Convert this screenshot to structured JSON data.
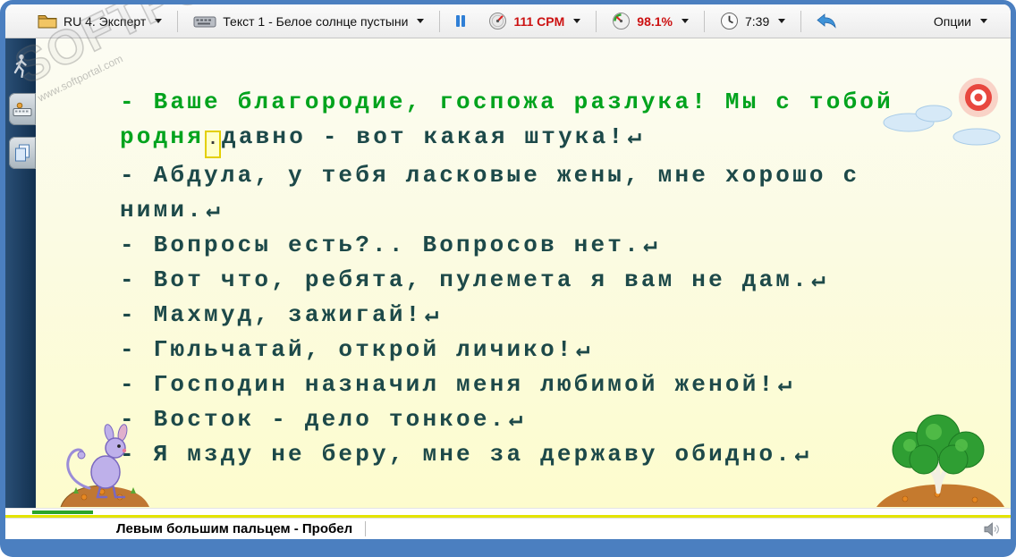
{
  "window": {
    "frame_color": "#4b7fc0"
  },
  "toolbar": {
    "lesson": {
      "label": "RU 4. Эксперт"
    },
    "text": {
      "label": "Текст 1 - Белое солнце пустыни"
    },
    "speed": {
      "value": "111 CPM"
    },
    "accuracy": {
      "value": "98.1%"
    },
    "time": {
      "value": "7:39"
    },
    "options": {
      "label": "Опции"
    }
  },
  "colors": {
    "typed": "#00a31d",
    "untyped": "#1d4949",
    "stat-red": "#cc1111",
    "frame": "#4b7fc0"
  },
  "icons": [
    "folder-icon",
    "keyboard-icon",
    "pause-icon",
    "speedometer-icon",
    "accuracy-gauge-icon",
    "clock-icon",
    "undo-arrow-icon",
    "dropdown-caret-icon",
    "walking-person-icon",
    "hands-keyboard-icon",
    "copy-pages-icon",
    "speaker-icon",
    "sun-clouds-decoration",
    "jerboa-mouse-decoration",
    "saxaul-tree-decoration"
  ],
  "typing": {
    "cursor_char": "·",
    "return_symbol": "↵",
    "lines": [
      {
        "typed": "- Ваше благородие, госпожа разлука! Мы с тобой",
        "rest": "",
        "cursor": false,
        "eol": false
      },
      {
        "typed": "родня",
        "cursor": true,
        "rest": "давно - вот какая штука!",
        "eol": true
      },
      {
        "typed": "",
        "rest": "- Абдула, у тебя ласковые жены, мне хорошо с",
        "eol": false
      },
      {
        "typed": "",
        "rest": "ними.",
        "eol": true
      },
      {
        "typed": "",
        "rest": "- Вопросы есть?.. Вопросов нет.",
        "eol": true
      },
      {
        "typed": "",
        "rest": "- Вот что, ребята, пулемета я вам не дам.",
        "eol": true
      },
      {
        "typed": "",
        "rest": "- Махмуд, зажигай!",
        "eol": true
      },
      {
        "typed": "",
        "rest": "- Гюльчатай, открой личико!",
        "eol": true
      },
      {
        "typed": "",
        "rest": "- Господин назначил меня любимой женой!",
        "eol": true
      },
      {
        "typed": "",
        "rest": "- Восток - дело тонкое.",
        "eol": true
      },
      {
        "typed": "",
        "rest": "- Я мзду не беру, мне за державу обидно.",
        "eol": true
      }
    ]
  },
  "statusbar": {
    "hint": "Левым большим пальцем - Пробел"
  },
  "watermark": {
    "title": "SOFTPORTAL",
    "subtitle": "www.softportal.com"
  }
}
